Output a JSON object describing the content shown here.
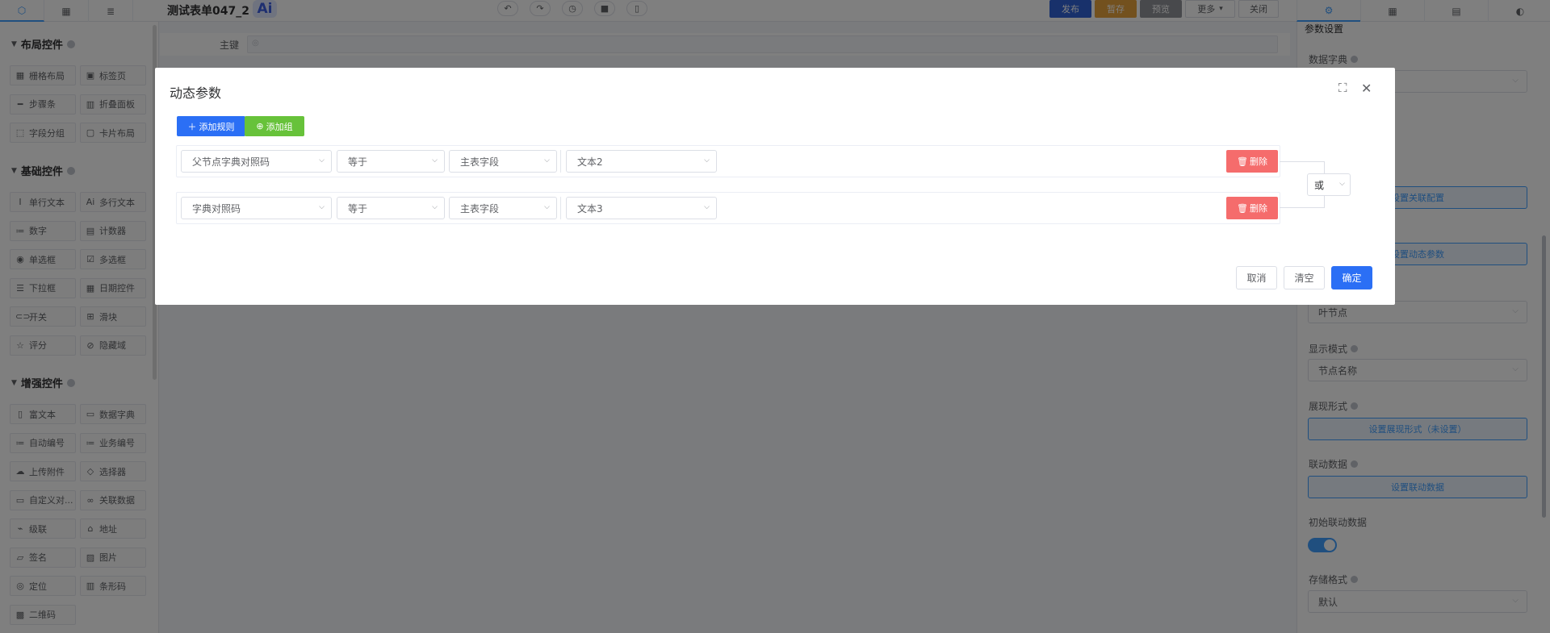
{
  "topbar": {
    "form_title": "测试表单047_2",
    "ai_label": "Ai",
    "publish": "发布",
    "save_draft": "暂存",
    "preview": "预览",
    "more": "更多",
    "close": "关闭"
  },
  "left_panel": {
    "layout_title": "布局控件",
    "layout_items": [
      {
        "label": "栅格布局",
        "icon": "grid-icon"
      },
      {
        "label": "标签页",
        "icon": "tabs-icon"
      },
      {
        "label": "步骤条",
        "icon": "steps-icon"
      },
      {
        "label": "折叠面板",
        "icon": "collapse-icon"
      },
      {
        "label": "字段分组",
        "icon": "group-icon"
      },
      {
        "label": "卡片布局",
        "icon": "card-icon"
      }
    ],
    "basic_title": "基础控件",
    "basic_items": [
      {
        "label": "单行文本",
        "icon": "text-icon"
      },
      {
        "label": "多行文本",
        "icon": "textarea-icon"
      },
      {
        "label": "数字",
        "icon": "number-icon"
      },
      {
        "label": "计数器",
        "icon": "counter-icon"
      },
      {
        "label": "单选框",
        "icon": "radio-icon"
      },
      {
        "label": "多选框",
        "icon": "checkbox-icon"
      },
      {
        "label": "下拉框",
        "icon": "dropdown-icon"
      },
      {
        "label": "日期控件",
        "icon": "calendar-icon"
      },
      {
        "label": "开关",
        "icon": "switch-icon"
      },
      {
        "label": "滑块",
        "icon": "slider-icon"
      },
      {
        "label": "评分",
        "icon": "star-icon"
      },
      {
        "label": "隐藏域",
        "icon": "hidden-icon"
      }
    ],
    "enhanced_title": "增强控件",
    "enhanced_items": [
      {
        "label": "富文本",
        "icon": "richtext-icon"
      },
      {
        "label": "数据字典",
        "icon": "dictionary-icon"
      },
      {
        "label": "自动编号",
        "icon": "autonumber-icon"
      },
      {
        "label": "业务编号",
        "icon": "business-number-icon"
      },
      {
        "label": "上传附件",
        "icon": "upload-icon"
      },
      {
        "label": "选择器",
        "icon": "selector-icon"
      },
      {
        "label": "自定义对...",
        "icon": "custom-dialog-icon"
      },
      {
        "label": "关联数据",
        "icon": "link-icon"
      },
      {
        "label": "级联",
        "icon": "cascade-icon"
      },
      {
        "label": "地址",
        "icon": "address-icon"
      },
      {
        "label": "签名",
        "icon": "signature-icon"
      },
      {
        "label": "图片",
        "icon": "image-icon"
      },
      {
        "label": "定位",
        "icon": "location-icon"
      },
      {
        "label": "条形码",
        "icon": "barcode-icon"
      },
      {
        "label": "二维码",
        "icon": "qrcode-icon"
      }
    ]
  },
  "canvas": {
    "field_label": "主键"
  },
  "right_panel": {
    "title": "参数设置",
    "dict_label": "数据字典",
    "relation_btn": "设置关联配置",
    "dynamic_btn": "设置动态参数",
    "node_value": "叶节点",
    "display_mode_label": "显示模式",
    "display_mode_value": "节点名称",
    "show_form_label": "展现形式",
    "show_form_btn": "设置展现形式（未设置）",
    "linkage_label": "联动数据",
    "linkage_btn": "设置联动数据",
    "init_linkage_label": "初始联动数据",
    "init_linkage_on": true,
    "storage_label": "存储格式",
    "storage_value": "默认"
  },
  "dialog": {
    "title": "动态参数",
    "add_rule": "添加规则",
    "add_group": "添加组",
    "rules": [
      {
        "field": "父节点字典对照码",
        "operator": "等于",
        "source": "主表字段",
        "value": "文本2",
        "delete": "删除"
      },
      {
        "field": "字典对照码",
        "operator": "等于",
        "source": "主表字段",
        "value": "文本3",
        "delete": "删除"
      }
    ],
    "logic": "或",
    "cancel": "取消",
    "clear": "清空",
    "confirm": "确定"
  },
  "colors": {
    "primary": "#2b6ff5",
    "success": "#67c23a",
    "danger": "#f56c6c",
    "publish": "#3063d6",
    "draft": "#e6a23c",
    "preview": "#909399"
  }
}
